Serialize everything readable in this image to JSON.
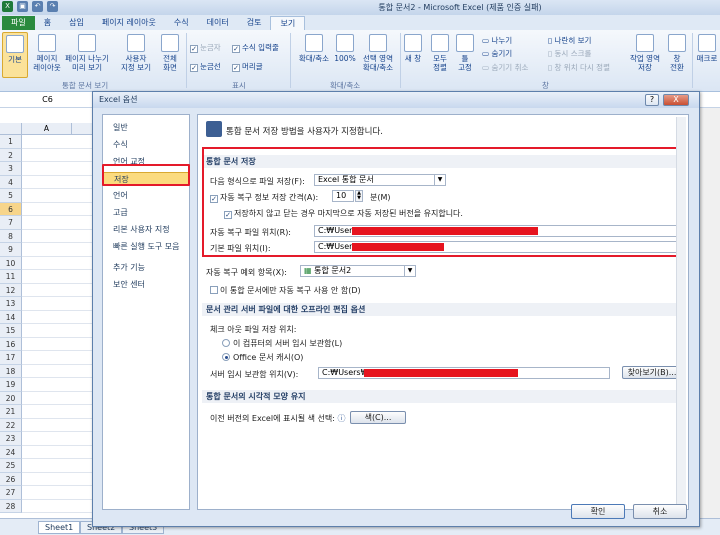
{
  "window": {
    "title": "통합 문서2 - Microsoft Excel (제품 인증 실패)"
  },
  "ribbon_tabs": [
    "파일",
    "홈",
    "삽입",
    "페이지 레이아웃",
    "수식",
    "데이터",
    "검토",
    "보기"
  ],
  "active_tab": "보기",
  "ribbon": {
    "normal": "기본",
    "page_layout": "페이지\n레이아웃",
    "page_break": "페이지 나누기\n미리 보기",
    "custom_views": "사용자\n지정 보기",
    "full_screen": "전체\n화면",
    "ruler": "눈금자",
    "formula_bar": "수식 입력줄",
    "gridlines": "눈금선",
    "headings": "머리글",
    "zoom": "확대/축소",
    "zoom100": "100%",
    "zoom_selection": "선택 영역\n확대/축소",
    "new_window": "새 창",
    "arrange_all": "모두\n정렬",
    "freeze_panes": "틀\n고정",
    "split": "나누기",
    "hide": "숨기기",
    "unhide": "숨기기 취소",
    "view_side": "나란히 보기",
    "sync_scroll": "동시 스크롤",
    "reset_pos": "창 위치 다시 정렬",
    "save_workspace": "작업 영역\n저장",
    "switch_windows": "창\n전환",
    "macros": "매크로",
    "group_views": "통합 문서 보기",
    "group_show": "표시",
    "group_zoom": "확대/축소",
    "group_window": "창"
  },
  "name_box": "C6",
  "sheet": {
    "columns": [
      "A"
    ],
    "rows": [
      "1",
      "2",
      "3",
      "4",
      "5",
      "6",
      "7",
      "8",
      "9",
      "10",
      "11",
      "12",
      "13",
      "14",
      "15",
      "16",
      "17",
      "18",
      "19",
      "20",
      "21",
      "22",
      "23",
      "24",
      "25",
      "26",
      "27",
      "28"
    ],
    "tabs": [
      "Sheet1",
      "Sheet2",
      "Sheet3"
    ]
  },
  "dialog": {
    "title": "Excel 옵션",
    "help": "?",
    "close": "X",
    "nav": [
      "일반",
      "수식",
      "언어 교정",
      "저장",
      "언어",
      "고급",
      "리본 사용자 지정",
      "빠른 실행 도구 모음",
      "추가 기능",
      "보안 센터"
    ],
    "active_nav": "저장",
    "heading": "통합 문서 저장 방법을 사용자가 지정합니다.",
    "save_section": "통합 문서 저장",
    "save_format_label": "다음 형식으로 파일 저장(F):",
    "save_format_value": "Excel 통합 문서",
    "autorecover_label": "자동 복구 정보 저장 간격(A):",
    "autorecover_minutes": "10",
    "minutes_unit": "분(M)",
    "keep_last_label": "저장하지 않고 닫는 경우 마지막으로 자동 저장된 버전을 유지합니다.",
    "autorecover_path_label": "자동 복구 파일 위치(R):",
    "autorecover_path_value": "C:₩Users₩",
    "default_path_label": "기본 파일 위치(I):",
    "default_path_value": "C:₩Users₩",
    "exceptions_label": "자동 복구 예외 항목(X):",
    "exceptions_value": "통합 문서2",
    "disable_autorecover_label": "이 통합 문서에만 자동 복구 사용 안 함(D)",
    "offline_section": "문서 관리 서버 파일에 대한 오프라인 편집 옵션",
    "checkout_label": "체크 아웃 파일 저장 위치:",
    "radio_server_drafts": "이 컴퓨터의 서버 임시 보관함(L)",
    "radio_office_cache": "Office 문서 캐시(O)",
    "server_drafts_label": "서버 임시 보관함 위치(V):",
    "server_drafts_value": "C:₩Users₩",
    "browse_button": "찾아보기(B)...",
    "visual_section": "통합 문서의 시각적 모양 유지",
    "colors_label": "이전 버전의 Excel에 표시될 색 선택:",
    "colors_button": "색(C)...",
    "ok_button": "확인",
    "cancel_button": "취소"
  },
  "colors": {
    "highlight": "#e41a2a",
    "file_tab": "#2a8a3e",
    "nav_selected": "#fbdb7f"
  }
}
